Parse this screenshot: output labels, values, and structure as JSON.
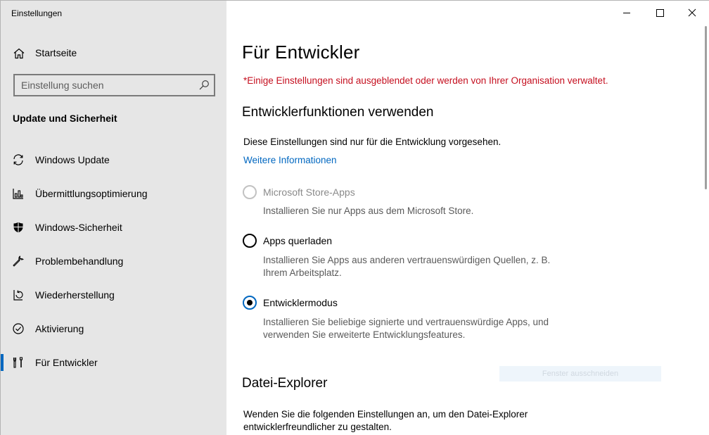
{
  "window": {
    "title": "Einstellungen"
  },
  "sidebar": {
    "home_label": "Startseite",
    "search_placeholder": "Einstellung suchen",
    "section_title": "Update und Sicherheit",
    "items": [
      {
        "label": "Windows Update",
        "icon": "sync-icon"
      },
      {
        "label": "Übermittlungsoptimierung",
        "icon": "delivery-optimization-icon"
      },
      {
        "label": "Windows-Sicherheit",
        "icon": "shield-icon"
      },
      {
        "label": "Problembehandlung",
        "icon": "wrench-icon"
      },
      {
        "label": "Wiederherstellung",
        "icon": "recovery-icon"
      },
      {
        "label": "Aktivierung",
        "icon": "check-circle-icon"
      },
      {
        "label": "Für Entwickler",
        "icon": "developer-tools-icon",
        "active": true
      }
    ]
  },
  "main": {
    "title": "Für Entwickler",
    "warning": "*Einige Einstellungen sind ausgeblendet oder werden von Ihrer Organisation verwaltet.",
    "dev_section": {
      "heading": "Entwicklerfunktionen verwenden",
      "intro": "Diese Einstellungen sind nur für die Entwicklung vorgesehen.",
      "link": "Weitere Informationen",
      "options": [
        {
          "label": "Microsoft Store-Apps",
          "description": "Installieren Sie nur Apps aus dem Microsoft Store.",
          "disabled": true,
          "checked": false
        },
        {
          "label": "Apps querladen",
          "description": "Installieren Sie Apps aus anderen vertrauenswürdigen Quellen, z. B. Ihrem Arbeitsplatz.",
          "disabled": false,
          "checked": false
        },
        {
          "label": "Entwicklermodus",
          "description": "Installieren Sie beliebige signierte und vertrauenswürdige Apps, und verwenden Sie erweiterte Entwicklungsfeatures.",
          "disabled": false,
          "checked": true
        }
      ]
    },
    "explorer_section": {
      "heading": "Datei-Explorer",
      "intro": "Wenden Sie die folgenden Einstellungen an, um den Datei-Explorer entwicklerfreundlicher zu gestalten."
    },
    "snip_overlay": "Fenster ausschneiden"
  },
  "colors": {
    "accent": "#0067c0",
    "warning": "#c50f1f",
    "sidebar_bg": "#e6e6e6"
  }
}
